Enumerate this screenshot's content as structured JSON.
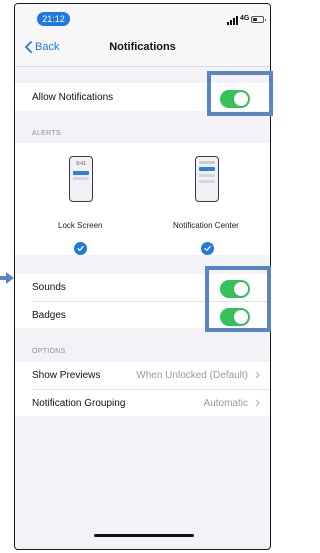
{
  "status": {
    "time": "21:12",
    "network": "4G"
  },
  "nav": {
    "back_label": "Back",
    "title": "Notifications"
  },
  "allow": {
    "label": "Allow Notifications",
    "on": true
  },
  "alerts": {
    "header": "ALERTS",
    "lock_time": "9:41",
    "options": [
      {
        "label": "Lock Screen",
        "checked": true
      },
      {
        "label": "Notification Center",
        "checked": true
      }
    ]
  },
  "sounds": {
    "label": "Sounds",
    "on": true
  },
  "badges": {
    "label": "Badges",
    "on": true
  },
  "options": {
    "header": "OPTIONS",
    "show_previews": {
      "label": "Show Previews",
      "value": "When Unlocked (Default)"
    },
    "grouping": {
      "label": "Notification Grouping",
      "value": "Automatic"
    }
  },
  "colors": {
    "accent": "#1f7ae0",
    "toggle_on": "#36c25a",
    "highlight": "#5b84c2"
  }
}
